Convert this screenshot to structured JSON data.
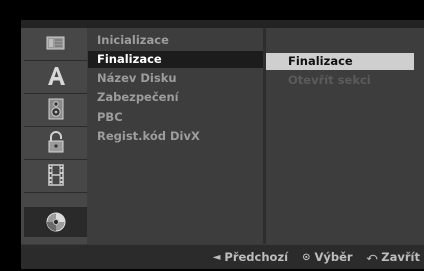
{
  "menu": {
    "items": [
      {
        "label": "Inicializace"
      },
      {
        "label": "Finalizace"
      },
      {
        "label": "Název Disku"
      },
      {
        "label": "Zabezpečení"
      },
      {
        "label": "PBC"
      },
      {
        "label": "Regist.kód DivX"
      }
    ],
    "selected_index": 1
  },
  "submenu": {
    "items": [
      {
        "label": "Finalizace"
      },
      {
        "label": "Otevřít sekci"
      }
    ]
  },
  "sidebar": {
    "icons": [
      "disc-list-icon",
      "letter-a-icon",
      "speaker-icon",
      "lock-icon",
      "film-icon",
      "disc-icon"
    ]
  },
  "footer": {
    "prev_label": "Předchozí",
    "select_label": "Výběr",
    "close_label": "Zavřít"
  }
}
